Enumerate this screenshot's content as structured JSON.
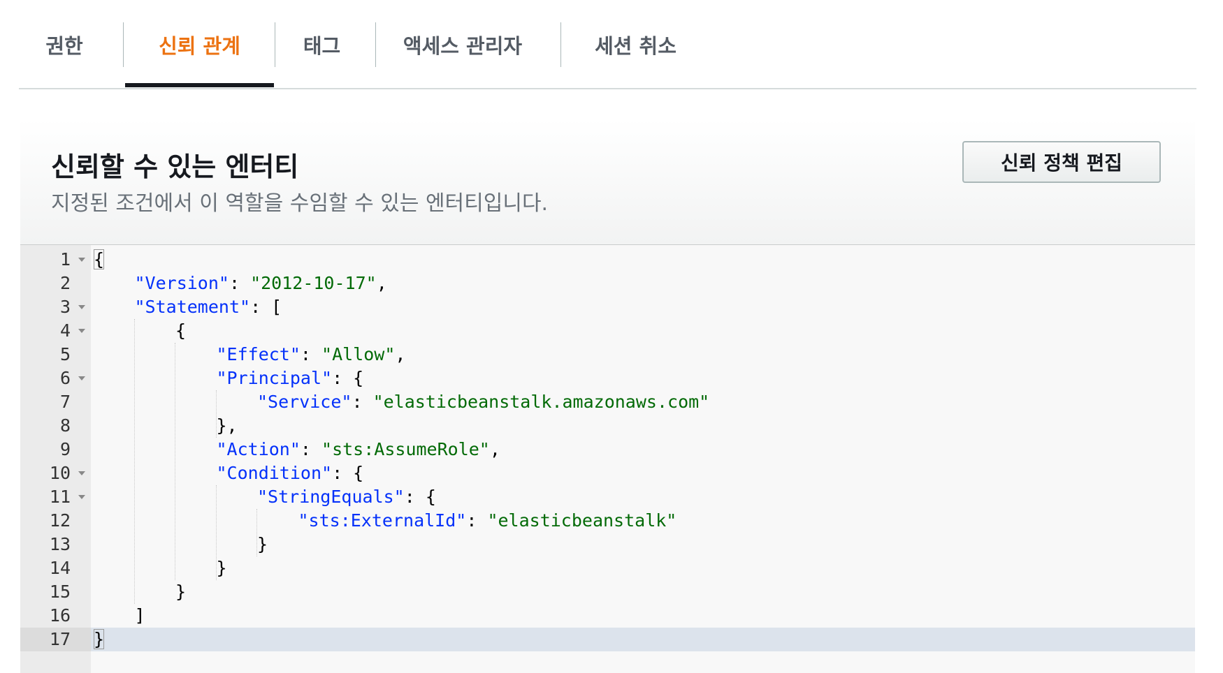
{
  "tabs": [
    {
      "label": "권한"
    },
    {
      "label": "신뢰 관계"
    },
    {
      "label": "태그"
    },
    {
      "label": "액세스 관리자"
    },
    {
      "label": "세션 취소"
    }
  ],
  "active_tab_index": 1,
  "section": {
    "title": "신뢰할 수 있는 엔터티",
    "subtitle": "지정된 조건에서 이 역할을 수임할 수 있는 엔터티입니다.",
    "edit_button_label": "신뢰 정책 편집"
  },
  "editor": {
    "active_line": 17,
    "lines": [
      {
        "n": "1",
        "fold": true,
        "indent": 0,
        "tokens": [
          {
            "t": "p",
            "v": "{"
          }
        ]
      },
      {
        "n": "2",
        "fold": false,
        "indent": 1,
        "tokens": [
          {
            "t": "k",
            "v": "\"Version\""
          },
          {
            "t": "p",
            "v": ": "
          },
          {
            "t": "s",
            "v": "\"2012-10-17\""
          },
          {
            "t": "p",
            "v": ","
          }
        ]
      },
      {
        "n": "3",
        "fold": true,
        "indent": 1,
        "tokens": [
          {
            "t": "k",
            "v": "\"Statement\""
          },
          {
            "t": "p",
            "v": ": ["
          }
        ]
      },
      {
        "n": "4",
        "fold": true,
        "indent": 2,
        "tokens": [
          {
            "t": "p",
            "v": "{"
          }
        ]
      },
      {
        "n": "5",
        "fold": false,
        "indent": 3,
        "tokens": [
          {
            "t": "k",
            "v": "\"Effect\""
          },
          {
            "t": "p",
            "v": ": "
          },
          {
            "t": "s",
            "v": "\"Allow\""
          },
          {
            "t": "p",
            "v": ","
          }
        ]
      },
      {
        "n": "6",
        "fold": true,
        "indent": 3,
        "tokens": [
          {
            "t": "k",
            "v": "\"Principal\""
          },
          {
            "t": "p",
            "v": ": {"
          }
        ]
      },
      {
        "n": "7",
        "fold": false,
        "indent": 4,
        "tokens": [
          {
            "t": "k",
            "v": "\"Service\""
          },
          {
            "t": "p",
            "v": ": "
          },
          {
            "t": "s",
            "v": "\"elasticbeanstalk.amazonaws.com\""
          }
        ]
      },
      {
        "n": "8",
        "fold": false,
        "indent": 3,
        "tokens": [
          {
            "t": "p",
            "v": "},"
          }
        ]
      },
      {
        "n": "9",
        "fold": false,
        "indent": 3,
        "tokens": [
          {
            "t": "k",
            "v": "\"Action\""
          },
          {
            "t": "p",
            "v": ": "
          },
          {
            "t": "s",
            "v": "\"sts:AssumeRole\""
          },
          {
            "t": "p",
            "v": ","
          }
        ]
      },
      {
        "n": "10",
        "fold": true,
        "indent": 3,
        "tokens": [
          {
            "t": "k",
            "v": "\"Condition\""
          },
          {
            "t": "p",
            "v": ": {"
          }
        ]
      },
      {
        "n": "11",
        "fold": true,
        "indent": 4,
        "tokens": [
          {
            "t": "k",
            "v": "\"StringEquals\""
          },
          {
            "t": "p",
            "v": ": {"
          }
        ]
      },
      {
        "n": "12",
        "fold": false,
        "indent": 5,
        "tokens": [
          {
            "t": "k",
            "v": "\"sts:ExternalId\""
          },
          {
            "t": "p",
            "v": ": "
          },
          {
            "t": "s",
            "v": "\"elasticbeanstalk\""
          }
        ]
      },
      {
        "n": "13",
        "fold": false,
        "indent": 4,
        "tokens": [
          {
            "t": "p",
            "v": "}"
          }
        ]
      },
      {
        "n": "14",
        "fold": false,
        "indent": 3,
        "tokens": [
          {
            "t": "p",
            "v": "}"
          }
        ]
      },
      {
        "n": "15",
        "fold": false,
        "indent": 2,
        "tokens": [
          {
            "t": "p",
            "v": "}"
          }
        ]
      },
      {
        "n": "16",
        "fold": false,
        "indent": 1,
        "tokens": [
          {
            "t": "p",
            "v": "]"
          }
        ]
      },
      {
        "n": "17",
        "fold": false,
        "indent": 0,
        "tokens": [
          {
            "t": "p",
            "v": "}"
          }
        ]
      }
    ]
  },
  "colors": {
    "active_tab": "#ec7211",
    "json_key": "#0431fa",
    "json_string": "#036a07",
    "active_line_bg": "#dce3ec"
  }
}
